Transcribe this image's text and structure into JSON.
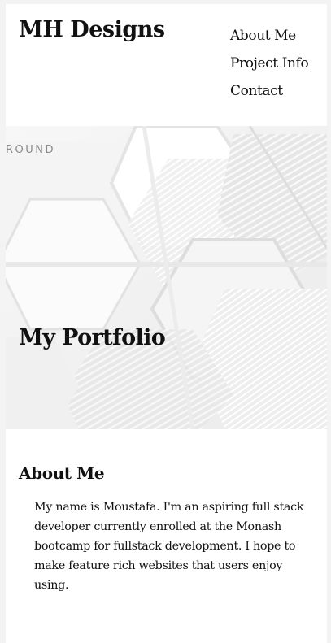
{
  "header": {
    "site_title": "MH Designs",
    "nav": [
      "About Me",
      "Project Info",
      "Contact"
    ]
  },
  "hero": {
    "background_caption": "ROUND",
    "title": "My Portfolio"
  },
  "about": {
    "heading": "About Me",
    "text": "My name is Moustafa. I'm an aspiring full stack developer currently enrolled at the Monash bootcamp for fullstack development. I hope to make feature rich websites that users enjoy using."
  },
  "colors": {
    "page_background": "#f3f3f3",
    "card_background": "#ffffff",
    "text": "#111111",
    "hero_background": "#f2f2f2"
  }
}
